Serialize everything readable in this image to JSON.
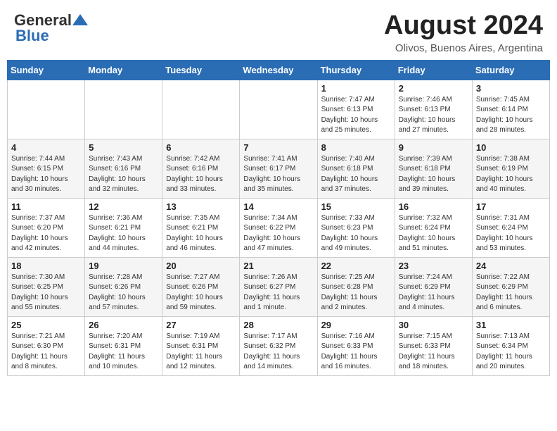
{
  "header": {
    "logo_general": "General",
    "logo_blue": "Blue",
    "month_year": "August 2024",
    "location": "Olivos, Buenos Aires, Argentina"
  },
  "columns": [
    "Sunday",
    "Monday",
    "Tuesday",
    "Wednesday",
    "Thursday",
    "Friday",
    "Saturday"
  ],
  "weeks": [
    [
      {
        "day": "",
        "info": ""
      },
      {
        "day": "",
        "info": ""
      },
      {
        "day": "",
        "info": ""
      },
      {
        "day": "",
        "info": ""
      },
      {
        "day": "1",
        "info": "Sunrise: 7:47 AM\nSunset: 6:13 PM\nDaylight: 10 hours and 25 minutes."
      },
      {
        "day": "2",
        "info": "Sunrise: 7:46 AM\nSunset: 6:13 PM\nDaylight: 10 hours and 27 minutes."
      },
      {
        "day": "3",
        "info": "Sunrise: 7:45 AM\nSunset: 6:14 PM\nDaylight: 10 hours and 28 minutes."
      }
    ],
    [
      {
        "day": "4",
        "info": "Sunrise: 7:44 AM\nSunset: 6:15 PM\nDaylight: 10 hours and 30 minutes."
      },
      {
        "day": "5",
        "info": "Sunrise: 7:43 AM\nSunset: 6:16 PM\nDaylight: 10 hours and 32 minutes."
      },
      {
        "day": "6",
        "info": "Sunrise: 7:42 AM\nSunset: 6:16 PM\nDaylight: 10 hours and 33 minutes."
      },
      {
        "day": "7",
        "info": "Sunrise: 7:41 AM\nSunset: 6:17 PM\nDaylight: 10 hours and 35 minutes."
      },
      {
        "day": "8",
        "info": "Sunrise: 7:40 AM\nSunset: 6:18 PM\nDaylight: 10 hours and 37 minutes."
      },
      {
        "day": "9",
        "info": "Sunrise: 7:39 AM\nSunset: 6:18 PM\nDaylight: 10 hours and 39 minutes."
      },
      {
        "day": "10",
        "info": "Sunrise: 7:38 AM\nSunset: 6:19 PM\nDaylight: 10 hours and 40 minutes."
      }
    ],
    [
      {
        "day": "11",
        "info": "Sunrise: 7:37 AM\nSunset: 6:20 PM\nDaylight: 10 hours and 42 minutes."
      },
      {
        "day": "12",
        "info": "Sunrise: 7:36 AM\nSunset: 6:21 PM\nDaylight: 10 hours and 44 minutes."
      },
      {
        "day": "13",
        "info": "Sunrise: 7:35 AM\nSunset: 6:21 PM\nDaylight: 10 hours and 46 minutes."
      },
      {
        "day": "14",
        "info": "Sunrise: 7:34 AM\nSunset: 6:22 PM\nDaylight: 10 hours and 47 minutes."
      },
      {
        "day": "15",
        "info": "Sunrise: 7:33 AM\nSunset: 6:23 PM\nDaylight: 10 hours and 49 minutes."
      },
      {
        "day": "16",
        "info": "Sunrise: 7:32 AM\nSunset: 6:24 PM\nDaylight: 10 hours and 51 minutes."
      },
      {
        "day": "17",
        "info": "Sunrise: 7:31 AM\nSunset: 6:24 PM\nDaylight: 10 hours and 53 minutes."
      }
    ],
    [
      {
        "day": "18",
        "info": "Sunrise: 7:30 AM\nSunset: 6:25 PM\nDaylight: 10 hours and 55 minutes."
      },
      {
        "day": "19",
        "info": "Sunrise: 7:28 AM\nSunset: 6:26 PM\nDaylight: 10 hours and 57 minutes."
      },
      {
        "day": "20",
        "info": "Sunrise: 7:27 AM\nSunset: 6:26 PM\nDaylight: 10 hours and 59 minutes."
      },
      {
        "day": "21",
        "info": "Sunrise: 7:26 AM\nSunset: 6:27 PM\nDaylight: 11 hours and 1 minute."
      },
      {
        "day": "22",
        "info": "Sunrise: 7:25 AM\nSunset: 6:28 PM\nDaylight: 11 hours and 2 minutes."
      },
      {
        "day": "23",
        "info": "Sunrise: 7:24 AM\nSunset: 6:29 PM\nDaylight: 11 hours and 4 minutes."
      },
      {
        "day": "24",
        "info": "Sunrise: 7:22 AM\nSunset: 6:29 PM\nDaylight: 11 hours and 6 minutes."
      }
    ],
    [
      {
        "day": "25",
        "info": "Sunrise: 7:21 AM\nSunset: 6:30 PM\nDaylight: 11 hours and 8 minutes."
      },
      {
        "day": "26",
        "info": "Sunrise: 7:20 AM\nSunset: 6:31 PM\nDaylight: 11 hours and 10 minutes."
      },
      {
        "day": "27",
        "info": "Sunrise: 7:19 AM\nSunset: 6:31 PM\nDaylight: 11 hours and 12 minutes."
      },
      {
        "day": "28",
        "info": "Sunrise: 7:17 AM\nSunset: 6:32 PM\nDaylight: 11 hours and 14 minutes."
      },
      {
        "day": "29",
        "info": "Sunrise: 7:16 AM\nSunset: 6:33 PM\nDaylight: 11 hours and 16 minutes."
      },
      {
        "day": "30",
        "info": "Sunrise: 7:15 AM\nSunset: 6:33 PM\nDaylight: 11 hours and 18 minutes."
      },
      {
        "day": "31",
        "info": "Sunrise: 7:13 AM\nSunset: 6:34 PM\nDaylight: 11 hours and 20 minutes."
      }
    ]
  ]
}
